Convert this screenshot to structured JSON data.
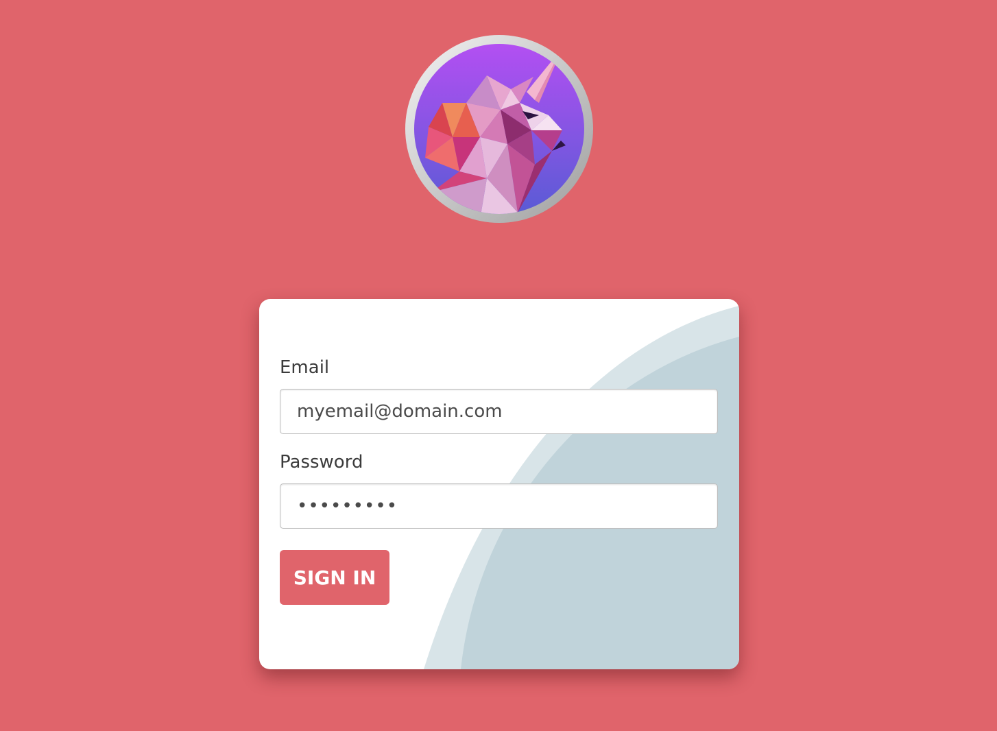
{
  "logo": {
    "icon": "unicorn-logo-icon"
  },
  "form": {
    "email_label": "Email",
    "email_value": "myemail@domain.com",
    "password_label": "Password",
    "password_value": "•••••••••",
    "submit_label": "SIGN IN"
  },
  "colors": {
    "background": "#e0646b",
    "button": "#e0646b",
    "card": "#ffffff",
    "card_curve_light": "#d8e4e8",
    "card_curve_dark": "#c0d3da",
    "logo_gradient_top": "#b14ff0",
    "logo_gradient_bottom": "#5c5ad6"
  }
}
